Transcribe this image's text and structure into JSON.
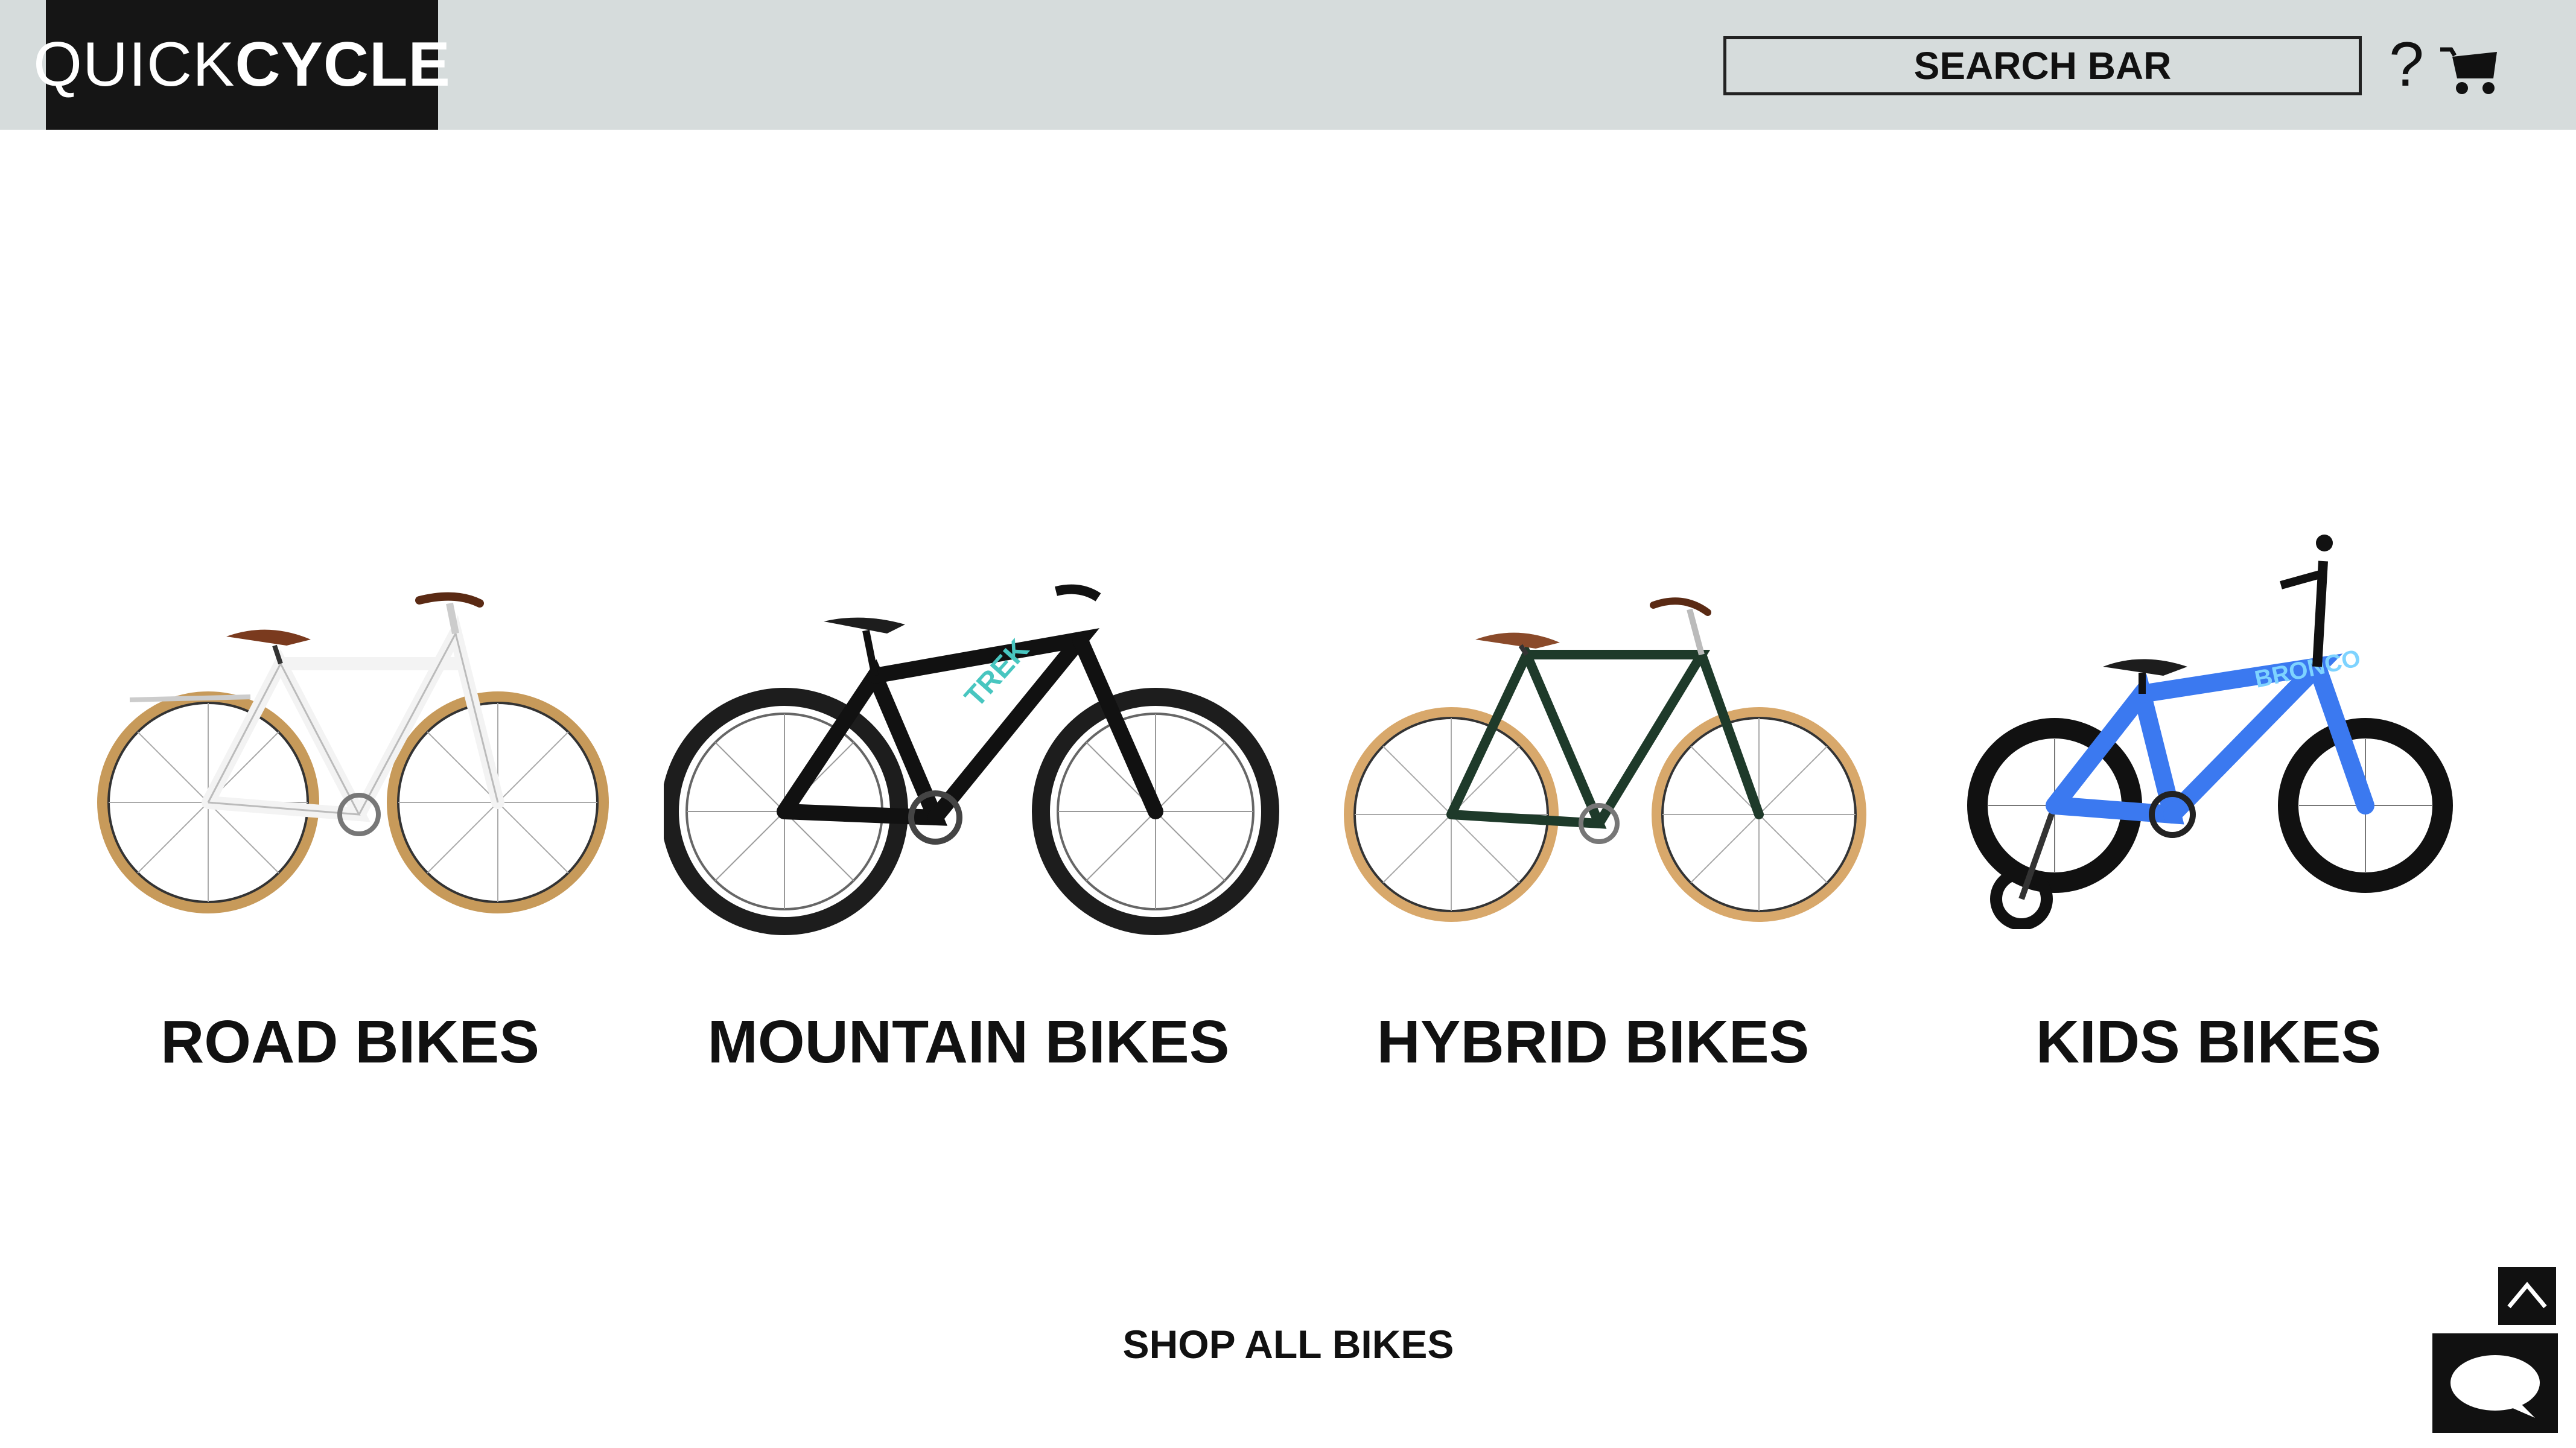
{
  "header": {
    "logo_light": "QUICK",
    "logo_bold": "CYCLE",
    "search_label": "SEARCH BAR",
    "help_label": "?"
  },
  "categories": [
    {
      "label": "ROAD BIKES",
      "frame_color": "#f3f3f3",
      "tire_color": "#c79a5a"
    },
    {
      "label": "MOUNTAIN BIKES",
      "frame_color": "#111111",
      "tire_color": "#1d1d1d"
    },
    {
      "label": "HYBRID BIKES",
      "frame_color": "#1e3a2a",
      "tire_color": "#d8a86b"
    },
    {
      "label": "KIDS BIKES",
      "frame_color": "#3b79f0",
      "tire_color": "#111111"
    }
  ],
  "footer": {
    "shop_all_label": "SHOP ALL BIKES"
  },
  "icons": [
    "cart-icon",
    "help-icon",
    "scroll-top-icon",
    "chat-icon"
  ]
}
